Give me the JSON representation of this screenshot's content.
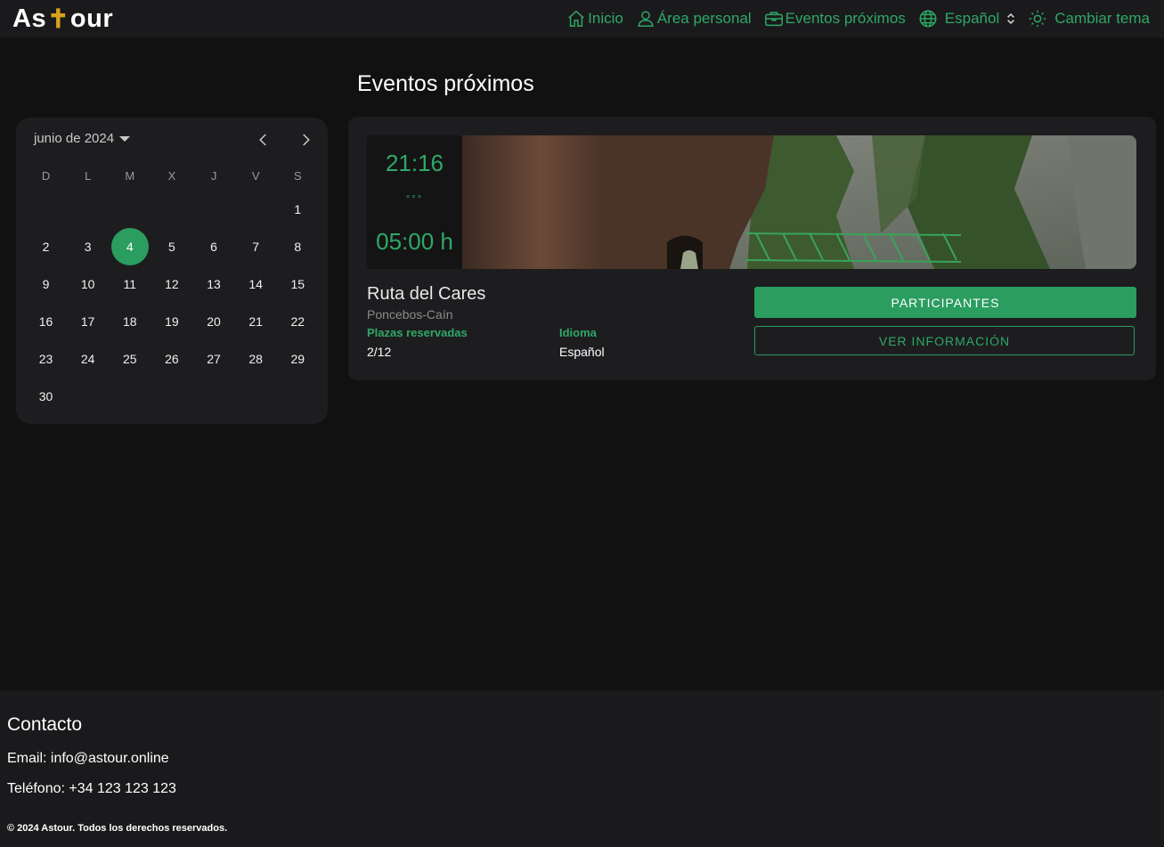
{
  "header": {
    "logo_left": "As",
    "logo_cross": "✝",
    "logo_right": "our",
    "nav": {
      "inicio": "Inicio",
      "area_personal": "Área personal",
      "eventos": "Eventos próximos",
      "idioma": "Español",
      "tema": "Cambiar tema"
    }
  },
  "page": {
    "title": "Eventos próximos"
  },
  "calendar": {
    "month_label": "junio de 2024",
    "weekdays": [
      "D",
      "L",
      "M",
      "X",
      "J",
      "V",
      "S"
    ],
    "weeks": [
      [
        "",
        "",
        "",
        "",
        "",
        "",
        "1"
      ],
      [
        "2",
        "3",
        "4",
        "5",
        "6",
        "7",
        "8"
      ],
      [
        "9",
        "10",
        "11",
        "12",
        "13",
        "14",
        "15"
      ],
      [
        "16",
        "17",
        "18",
        "19",
        "20",
        "21",
        "22"
      ],
      [
        "23",
        "24",
        "25",
        "26",
        "27",
        "28",
        "29"
      ],
      [
        "30",
        "",
        "",
        "",
        "",
        "",
        ""
      ]
    ],
    "selected_day": "4"
  },
  "event": {
    "start_time": "21:16",
    "dots": "°°°",
    "duration": "05:00 h",
    "title": "Ruta del Cares",
    "subtitle": "Poncebos-Caín",
    "plazas_label": "Plazas reservadas",
    "plazas_value": "2/12",
    "idioma_label": "Idioma",
    "idioma_value": "Español",
    "btn_participantes": "PARTICIPANTES",
    "btn_info": "VER INFORMACIÓN"
  },
  "footer": {
    "title": "Contacto",
    "email": "Email: info@astour.online",
    "phone": "Teléfono: +34 123 123 123",
    "copyright": "© 2024 Astour. Todos los derechos reservados."
  },
  "colors": {
    "accent": "#2a9d5f",
    "accent_text": "#2fa866",
    "logo_cross": "#d9a21b",
    "background": "#111112",
    "panel": "#1d1d20"
  }
}
